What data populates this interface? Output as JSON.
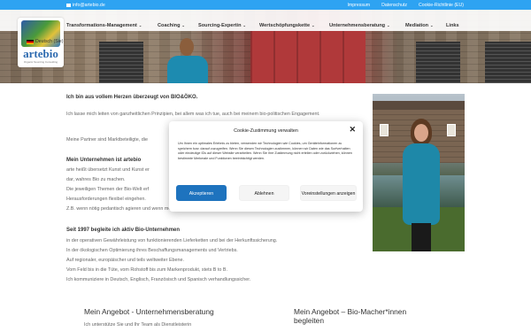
{
  "topbar": {
    "email": "info@artebio.de",
    "links": [
      "Impressum",
      "Datenschutz",
      "Cookie-Richtlinie (EU)"
    ]
  },
  "logo": {
    "name": "artebio",
    "tagline": "Organic Sourcing Consulting"
  },
  "language": "Deutsch (Sie)",
  "nav": {
    "items": [
      {
        "label": "Transformations-Management",
        "has_caret": true
      },
      {
        "label": "Coaching",
        "has_caret": true
      },
      {
        "label": "Sourcing-Expertin",
        "has_caret": true
      },
      {
        "label": "Wertschöpfungskette",
        "has_caret": true
      },
      {
        "label": "Unternehmensberatung",
        "has_caret": true
      },
      {
        "label": "Mediation",
        "has_caret": true
      },
      {
        "label": "Links",
        "has_caret": false
      }
    ]
  },
  "main": {
    "heading1": "Ich bin aus vollem Herzen überzeugt von BIO&ÖKO.",
    "para1": "Ich lasse mich leiten von ganzheitlichen Prinzipien, bei allem was ich tue, auch bei meinem bio-politischen Engagement.",
    "para2": "Meine Partner sind Marktbeteiligte, die",
    "heading2": "Mein Unternehmen ist artebio",
    "lines2": [
      "arte heißt übersetzt Kunst und Kunst er",
      "dar, wahres Bio zu machen.",
      "Die jeweiligen Themen der Bio-Welt erf",
      "Herausforderungen flexibel eingehen.",
      "Z.B. wenn nötig pedantisch agieren und wenn möglich großzügig."
    ],
    "heading3": "Seit 1997 begleite ich aktiv Bio-Unternehmen",
    "lines3": [
      "in der operativen Gewährleistung von funktionierenden Lieferketten und bei der Herkunftssicherung.",
      "In der ökologischen Optimierung ihres Beschaffungsmanagements und Vertriebs.",
      "Auf regionaler, europäischer und teils weltweiter Ebene.",
      "Vom Feld bis in die Tüte, vom Rohstoff bis zum Markenprodukt, stets B to B.",
      "Ich kommuniziere in Deutsch, Englisch, Französisch und Spanisch verhandlungssicher."
    ]
  },
  "bottom": {
    "left_title": "Mein Angebot - Unternehmensberatung",
    "left_sub": "Ich unterstütze Sie und Ihr Team als Dienstleisterin",
    "right_title_line1": "Mein Angebot – Bio-Macher*innen",
    "right_title_line2": "begleiten"
  },
  "cookie": {
    "title": "Cookie-Zustimmung verwalten",
    "text": "Um Ihnen ein optimales Erlebnis zu bieten, verwenden wir Technologien wie Cookies, um Geräteinformationen zu speichern bzw. darauf zuzugreifen. Wenn Sie diesen Technologien zustimmen, können wir Daten wie das Surfverhalten oder eindeutige IDs auf dieser Website verarbeiten. Wenn Sie Ihre Zustimmung nicht erteilen oder zurückziehen, können bestimmte Merkmale und Funktionen beeinträchtigt werden.",
    "accept": "Akzeptieren",
    "deny": "Ablehnen",
    "prefs": "Voreinstellungen anzeigen",
    "close": "✕"
  },
  "colors": {
    "topbar": "#2ea3f2",
    "accept_button": "#1e73be"
  },
  "icons": [
    "envelope-icon",
    "flag-de-icon",
    "chevron-down-icon",
    "close-icon"
  ]
}
